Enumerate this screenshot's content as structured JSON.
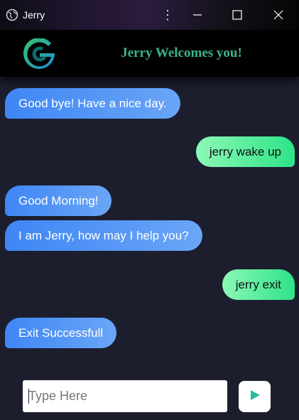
{
  "window": {
    "title": "Jerry",
    "menu_glyph": "⋮",
    "app_icon": "globe-icon",
    "controls": [
      "minimize-icon",
      "maximize-icon",
      "close-icon"
    ]
  },
  "header": {
    "logo": "g-logo-icon",
    "welcome_text": "Jerry Welcomes you!",
    "welcome_color": "#3bb38f"
  },
  "chat": {
    "messages": [
      {
        "sender": "bot",
        "text": "Good bye! Have a nice day."
      },
      {
        "sender": "user",
        "text": "jerry wake up"
      },
      {
        "sender": "bot",
        "text": "Good Morning!"
      },
      {
        "sender": "bot",
        "text": "I am Jerry, how may I help you?"
      },
      {
        "sender": "user",
        "text": "jerry exit"
      },
      {
        "sender": "bot",
        "text": "Exit Successfull"
      }
    ]
  },
  "composer": {
    "placeholder": "Type Here",
    "value": "",
    "send_icon": "send-icon",
    "send_icon_color": "#2bb9a1"
  },
  "colors": {
    "background": "#1c1e2e",
    "bot_bubble": "#3f86f5",
    "user_bubble": "#2ee387"
  }
}
